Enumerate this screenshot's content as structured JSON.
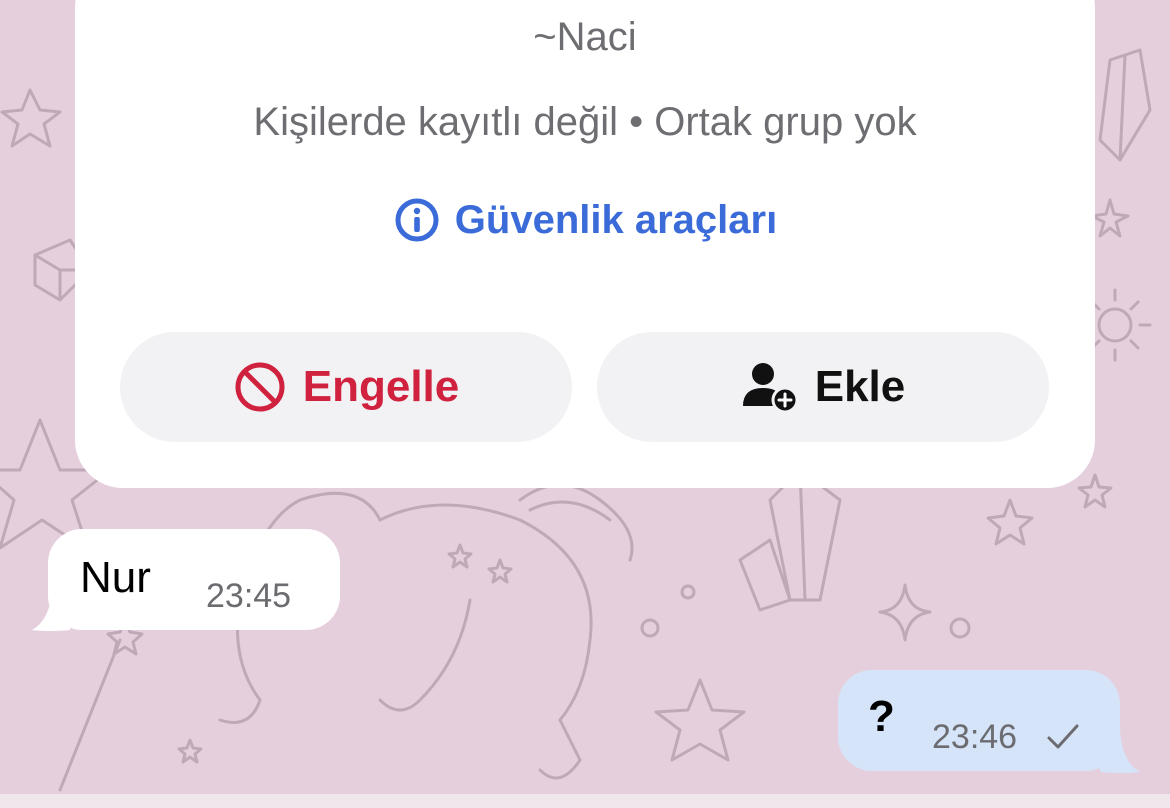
{
  "contact": {
    "name": "~Naci",
    "subtitle": "Kişilerde kayıtlı değil • Ortak grup yok",
    "safety_tools_label": "Güvenlik araçları"
  },
  "actions": {
    "block_label": "Engelle",
    "add_label": "Ekle"
  },
  "messages": [
    {
      "direction": "incoming",
      "text": "Nur",
      "time": "23:45"
    },
    {
      "direction": "outgoing",
      "text": "?",
      "time": "23:46",
      "status": "sent"
    }
  ],
  "colors": {
    "background": "#e5cfdd",
    "card": "#ffffff",
    "link_blue": "#3a6bd8",
    "block_red": "#d0213f",
    "outgoing_bubble": "#d5e4f9"
  },
  "icons": {
    "safety": "info-icon",
    "block": "block-icon",
    "add": "add-contact-icon",
    "status": "checkmark-icon"
  }
}
